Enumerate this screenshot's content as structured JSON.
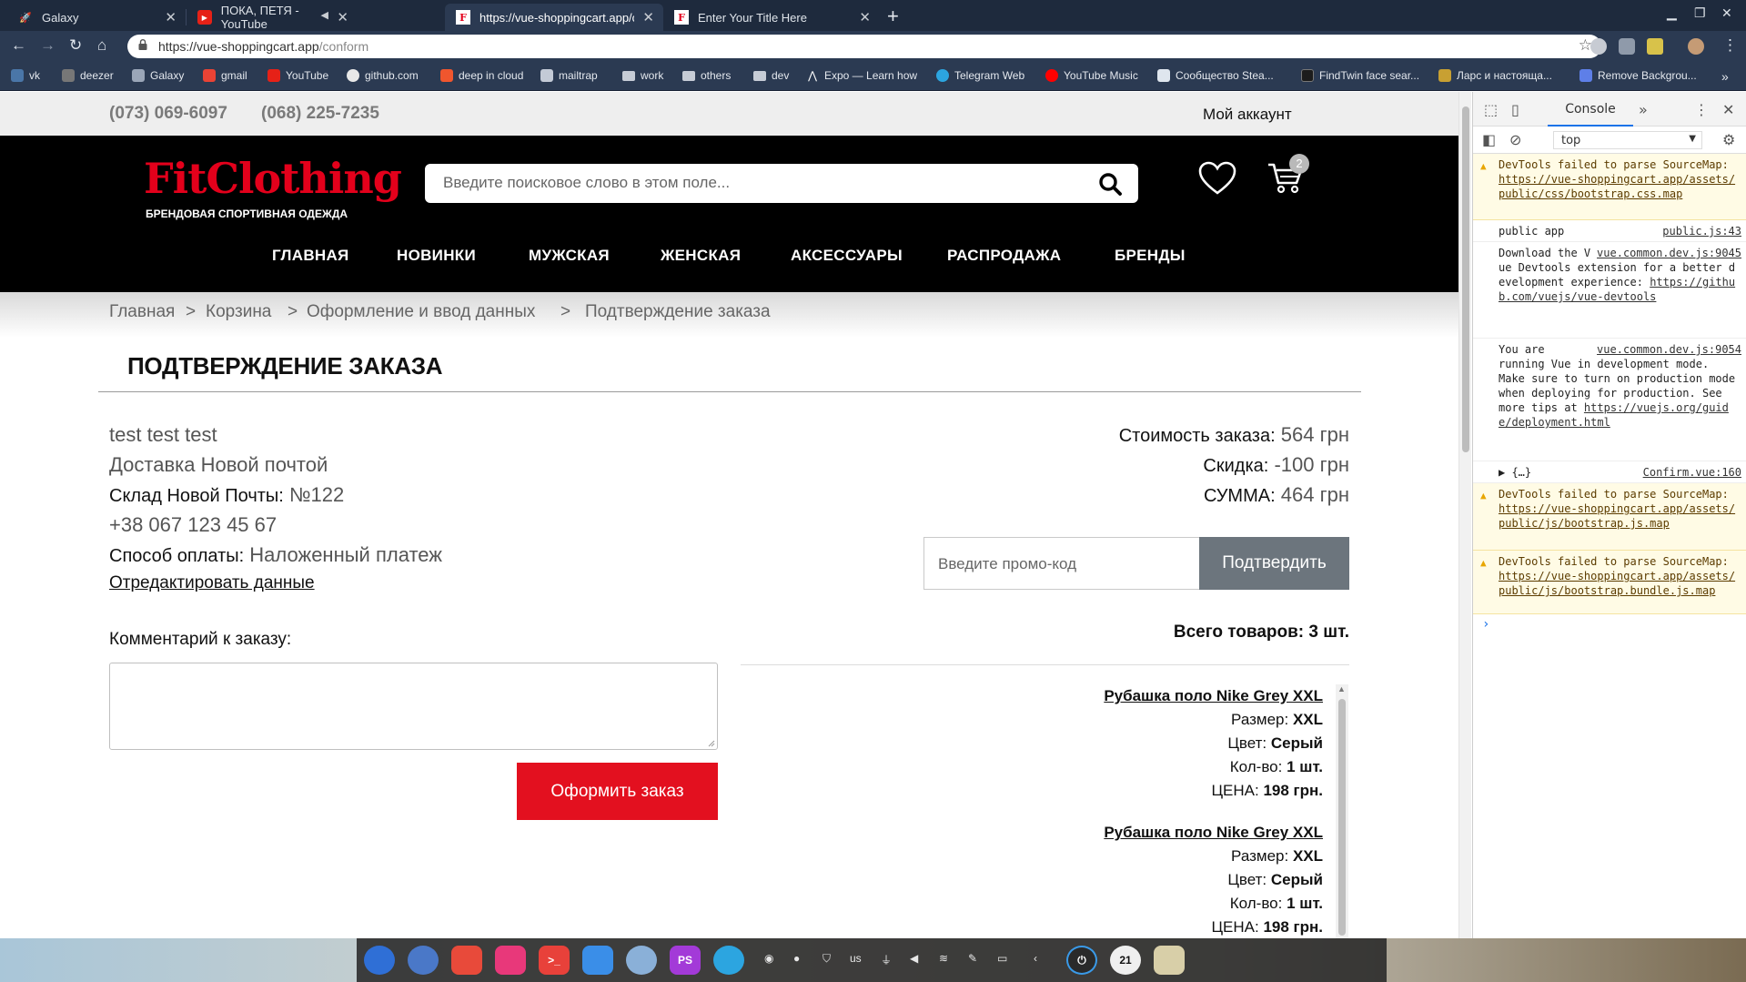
{
  "browser": {
    "tabs": [
      {
        "title": "Galaxy",
        "active": false
      },
      {
        "title": "ПОКА, ПЕТЯ - YouTube",
        "active": false
      },
      {
        "title": "https://vue-shoppingcart.app/c",
        "active": true
      },
      {
        "title": "Enter Your Title Here",
        "active": false
      }
    ],
    "url_host": "https://vue-shoppingcart.app",
    "url_path": "/conform",
    "bookmarks": [
      "vk",
      "deezer",
      "Galaxy",
      "gmail",
      "YouTube",
      "github.com",
      "deep in cloud",
      "mailtrap",
      "work",
      "others",
      "dev",
      "Expo — Learn how",
      "Telegram Web",
      "YouTube Music",
      "Сообщество Stea...",
      "FindTwin face sear...",
      "Ларс и настояща...",
      "Remove Backgrou..."
    ]
  },
  "site": {
    "phones": [
      "(073) 069-6097",
      "(068) 225-7235"
    ],
    "account_label": "Мой аккаунт",
    "logo": "FitClothing",
    "logo_sub": "БРЕНДОВАЯ СПОРТИВНАЯ ОДЕЖДА",
    "search_placeholder": "Введите поисковое слово в этом поле...",
    "cart_count": "2",
    "menu": [
      "ГЛАВНАЯ",
      "НОВИНКИ",
      "МУЖСКАЯ",
      "ЖЕНСКАЯ",
      "АКСЕССУАРЫ",
      "РАСПРОДАЖА",
      "БРЕНДЫ"
    ],
    "breadcrumbs": [
      "Главная",
      "Корзина",
      "Оформление и ввод данных",
      "Подтверждение заказа"
    ],
    "breadcrumb_separator": ">",
    "page_title": "ПОДТВЕРЖДЕНИЕ ЗАКАЗА"
  },
  "order": {
    "name": "test test test",
    "delivery": "Доставка Новой почтой",
    "warehouse_label": "Склад Новой Почты:",
    "warehouse_value": "№122",
    "phone": "+38 067 123 45 67",
    "payment_label": "Способ оплаты:",
    "payment_value": "Наложенный платеж",
    "edit_link": "Отредактировать данные",
    "cost_label": "Стоимость заказа:",
    "cost_value": "564 грн",
    "discount_label": "Скидка:",
    "discount_value": "-100 грн",
    "total_label": "СУММА:",
    "total_value": "464 грн",
    "promo_placeholder": "Введите промо-код",
    "promo_button": "Подтвердить",
    "items_total": "Всего товаров: 3 шт.",
    "comment_label": "Комментарий к заказу:",
    "submit_button": "Оформить заказ",
    "products": [
      {
        "name": "Рубашка поло Nike Grey XXL",
        "size_label": "Размер:",
        "size": "XXL",
        "color_label": "Цвет:",
        "color": "Серый",
        "qty_label": "Кол-во:",
        "qty": "1 шт.",
        "price_label": "ЦЕНА:",
        "price": "198 грн."
      },
      {
        "name": "Рубашка поло Nike Grey XXL",
        "size_label": "Размер:",
        "size": "XXL",
        "color_label": "Цвет:",
        "color": "Серый",
        "qty_label": "Кол-во:",
        "qty": "1 шт.",
        "price_label": "ЦЕНА:",
        "price": "198 грн."
      }
    ]
  },
  "devtools": {
    "tab": "Console",
    "context": "top",
    "messages": [
      {
        "type": "warn",
        "text": "DevTools failed to parse SourceMap: ",
        "link": "https://vue-shoppingcart.app/assets/public/css/bootstrap.css.map"
      },
      {
        "type": "log",
        "text": "public app",
        "source": "public.js:43"
      },
      {
        "type": "log",
        "source": "vue.common.dev.js:9045",
        "text": "Download the Vue Devtools extension for a better development experience:",
        "link": "https://github.com/vuejs/vue-devtools"
      },
      {
        "type": "log",
        "source": "vue.common.dev.js:9054",
        "text": "You are running Vue in development mode. Make sure to turn on production mode when deploying for production. See more tips at ",
        "link": "https://vuejs.org/guide/deployment.html"
      },
      {
        "type": "log",
        "text": "▶ {…}",
        "source": "Confirm.vue:160"
      },
      {
        "type": "warn",
        "text": "DevTools failed to parse SourceMap: ",
        "link": "https://vue-shoppingcart.app/assets/public/js/bootstrap.js.map"
      },
      {
        "type": "warn",
        "text": "DevTools failed to parse SourceMap: ",
        "link": "https://vue-shoppingcart.app/assets/public/js/bootstrap.bundle.js.map"
      }
    ]
  },
  "taskbar": {
    "keyboard": "us",
    "clock": "21"
  },
  "colors": {
    "brand_red": "#e3001b",
    "button_red": "#e3101f",
    "promo_button": "#6c757d",
    "browser_chrome": "#2b3a52"
  }
}
